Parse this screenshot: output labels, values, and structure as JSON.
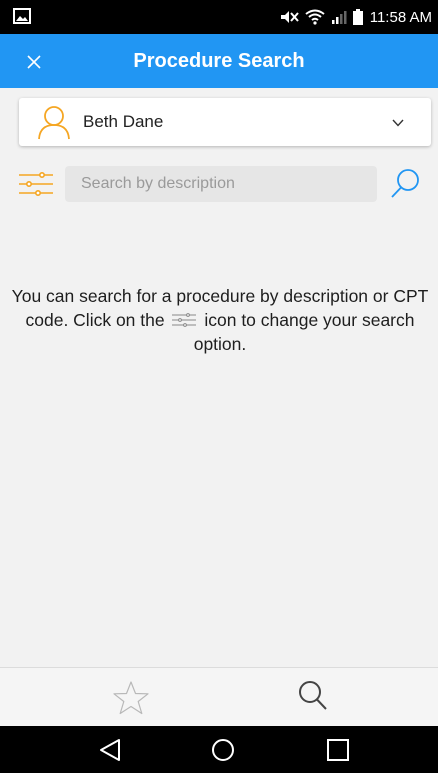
{
  "status_bar": {
    "time": "11:58 AM",
    "icons": [
      "image-icon",
      "mute-icon",
      "wifi-icon",
      "signal-icon",
      "battery-icon"
    ]
  },
  "app_bar": {
    "title": "Procedure Search",
    "close_icon": "close-icon",
    "background_color": "#2196f3"
  },
  "patient_selector": {
    "name": "Beth Dane",
    "avatar_icon": "person-icon",
    "dropdown_icon": "chevron-down-icon",
    "accent_color": "#f5a623"
  },
  "search": {
    "placeholder": "Search by description",
    "value": "",
    "filter_icon": "sliders-icon",
    "search_icon": "search-icon"
  },
  "help": {
    "text_before_icon": "You can search for a procedure by description or CPT code. Click on the",
    "text_after_icon": "icon to change your search option."
  },
  "bottom_tabs": [
    {
      "icon": "star-icon",
      "name": "favorites"
    },
    {
      "icon": "search-icon",
      "name": "search"
    }
  ],
  "nav_bar": {
    "buttons": [
      "back-icon",
      "home-icon",
      "recents-icon"
    ]
  }
}
